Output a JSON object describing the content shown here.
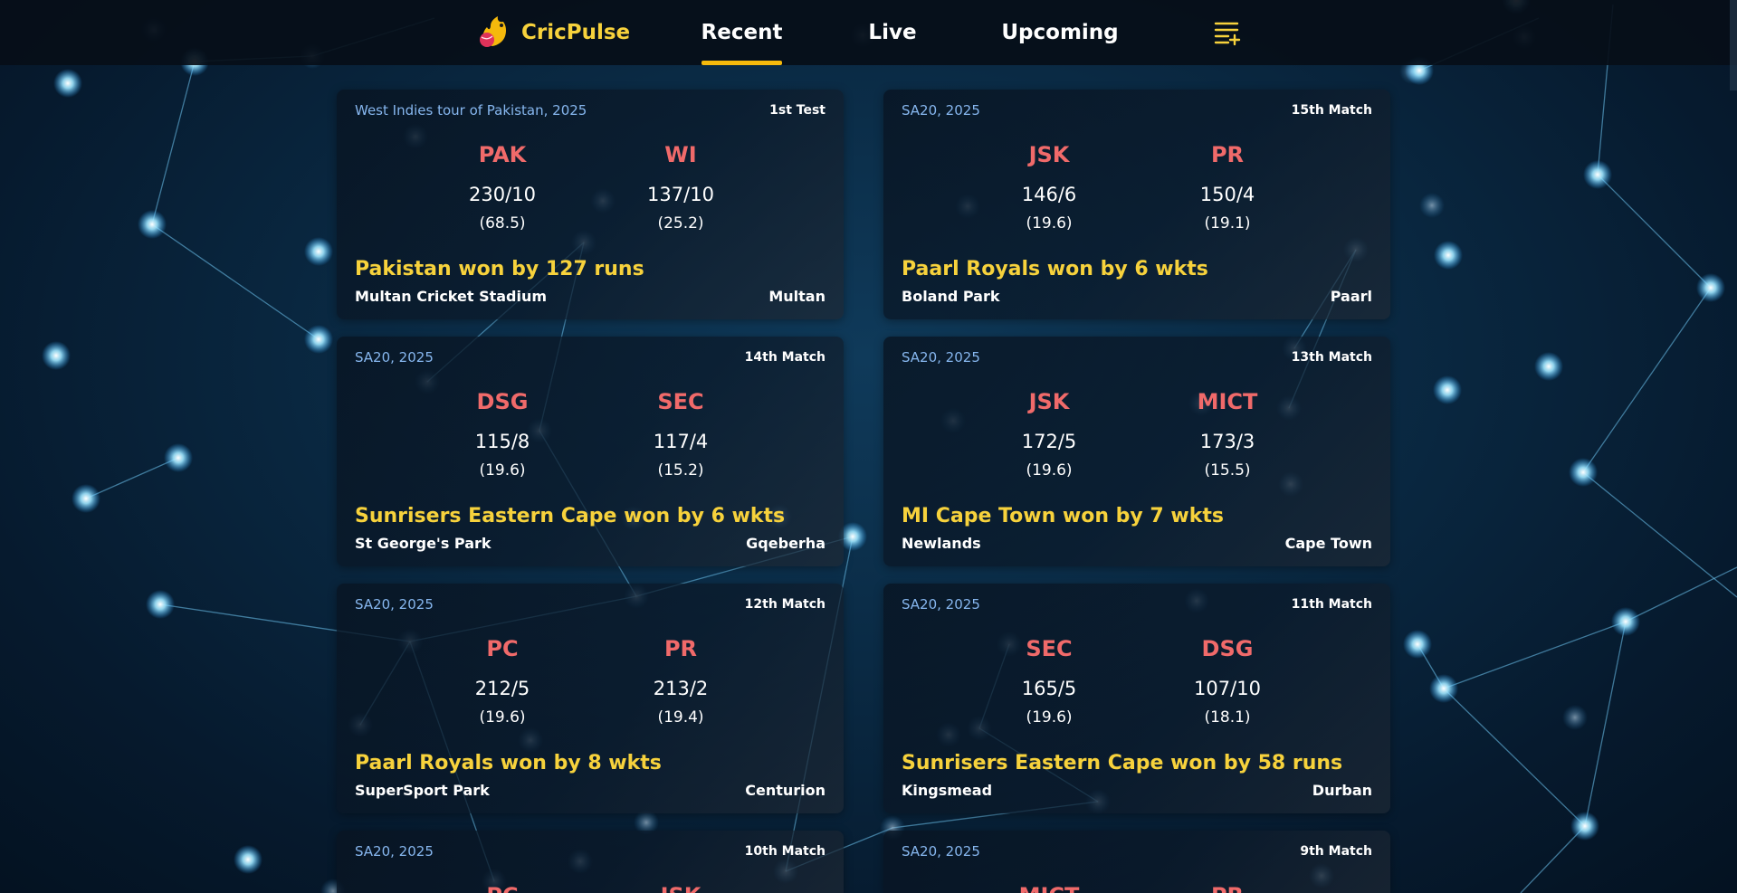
{
  "header": {
    "brand": "CricPulse",
    "tabs": [
      {
        "label": "Recent",
        "active": true
      },
      {
        "label": "Live",
        "active": false
      },
      {
        "label": "Upcoming",
        "active": false
      }
    ]
  },
  "colors": {
    "accent": "#f7d23c",
    "team": "#f06a6a",
    "series": "#86b6ee",
    "tab_underline": "#f5b90c"
  },
  "matches": [
    {
      "series": "West Indies tour of Pakistan, 2025",
      "match_no": "1st Test",
      "team1": {
        "name": "PAK",
        "score": "230/10",
        "overs": "(68.5)"
      },
      "team2": {
        "name": "WI",
        "score": "137/10",
        "overs": "(25.2)"
      },
      "result": "Pakistan won by 127 runs",
      "venue": "Multan Cricket Stadium",
      "city": "Multan"
    },
    {
      "series": "SA20, 2025",
      "match_no": "15th Match",
      "team1": {
        "name": "JSK",
        "score": "146/6",
        "overs": "(19.6)"
      },
      "team2": {
        "name": "PR",
        "score": "150/4",
        "overs": "(19.1)"
      },
      "result": "Paarl Royals won by 6 wkts",
      "venue": "Boland Park",
      "city": "Paarl"
    },
    {
      "series": "SA20, 2025",
      "match_no": "14th Match",
      "team1": {
        "name": "DSG",
        "score": "115/8",
        "overs": "(19.6)"
      },
      "team2": {
        "name": "SEC",
        "score": "117/4",
        "overs": "(15.2)"
      },
      "result": "Sunrisers Eastern Cape won by 6 wkts",
      "venue": "St George's Park",
      "city": "Gqeberha"
    },
    {
      "series": "SA20, 2025",
      "match_no": "13th Match",
      "team1": {
        "name": "JSK",
        "score": "172/5",
        "overs": "(19.6)"
      },
      "team2": {
        "name": "MICT",
        "score": "173/3",
        "overs": "(15.5)"
      },
      "result": "MI Cape Town won by 7 wkts",
      "venue": "Newlands",
      "city": "Cape Town"
    },
    {
      "series": "SA20, 2025",
      "match_no": "12th Match",
      "team1": {
        "name": "PC",
        "score": "212/5",
        "overs": "(19.6)"
      },
      "team2": {
        "name": "PR",
        "score": "213/2",
        "overs": "(19.4)"
      },
      "result": "Paarl Royals won by 8 wkts",
      "venue": "SuperSport Park",
      "city": "Centurion"
    },
    {
      "series": "SA20, 2025",
      "match_no": "11th Match",
      "team1": {
        "name": "SEC",
        "score": "165/5",
        "overs": "(19.6)"
      },
      "team2": {
        "name": "DSG",
        "score": "107/10",
        "overs": "(18.1)"
      },
      "result": "Sunrisers Eastern Cape won by 58 runs",
      "venue": "Kingsmead",
      "city": "Durban"
    },
    {
      "series": "SA20, 2025",
      "match_no": "10th Match",
      "team1": {
        "name": "PC",
        "score": "",
        "overs": ""
      },
      "team2": {
        "name": "JSK",
        "score": "",
        "overs": ""
      },
      "result": "",
      "venue": "",
      "city": ""
    },
    {
      "series": "SA20, 2025",
      "match_no": "9th Match",
      "team1": {
        "name": "MICT",
        "score": "",
        "overs": ""
      },
      "team2": {
        "name": "PR",
        "score": "",
        "overs": ""
      },
      "result": "",
      "venue": "",
      "city": ""
    }
  ]
}
